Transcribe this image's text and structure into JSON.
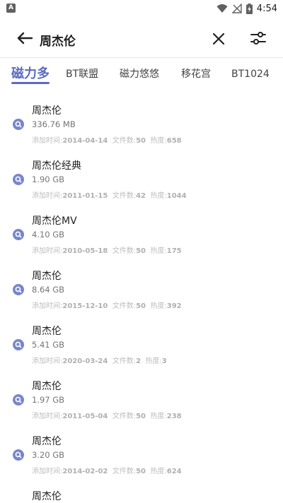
{
  "status_bar": {
    "left_icon": "A",
    "time": "4:54",
    "icons": [
      "wifi-icon",
      "no-signal-icon",
      "battery-charging-icon"
    ]
  },
  "toolbar": {
    "query": "周杰伦",
    "icons": [
      "back-arrow-icon",
      "close-icon",
      "filter-sliders-icon"
    ]
  },
  "tabs": [
    {
      "label": "磁力多",
      "active": true
    },
    {
      "label": "BT联盟",
      "active": false
    },
    {
      "label": "磁力悠悠",
      "active": false
    },
    {
      "label": "移花宫",
      "active": false
    },
    {
      "label": "BT1024",
      "active": false
    }
  ],
  "labels": {
    "added": "添加时间:",
    "files": "文件数:",
    "heat": "热度:"
  },
  "results": [
    {
      "title": "周杰伦",
      "size": "336.76 MB",
      "date": "2014-04-14",
      "files": "50",
      "heat": "658"
    },
    {
      "title": "周杰伦经典",
      "size": "1.90 GB",
      "date": "2011-01-15",
      "files": "42",
      "heat": "1044"
    },
    {
      "title": "周杰伦MV",
      "size": "4.10 GB",
      "date": "2010-05-18",
      "files": "50",
      "heat": "175"
    },
    {
      "title": "周杰伦",
      "size": "8.64 GB",
      "date": "2015-12-10",
      "files": "50",
      "heat": "392"
    },
    {
      "title": "周杰伦",
      "size": "5.41 GB",
      "date": "2020-03-24",
      "files": "2",
      "heat": "3"
    },
    {
      "title": "周杰伦",
      "size": "1.97 GB",
      "date": "2011-05-04",
      "files": "50",
      "heat": "238"
    },
    {
      "title": "周杰伦",
      "size": "3.20 GB",
      "date": "2014-02-02",
      "files": "50",
      "heat": "624"
    },
    {
      "title": "周杰伦",
      "size": "",
      "date": "",
      "files": "",
      "heat": ""
    }
  ],
  "colors": {
    "accent": "#5c6bc0",
    "icon_fill": "#7986cb"
  }
}
